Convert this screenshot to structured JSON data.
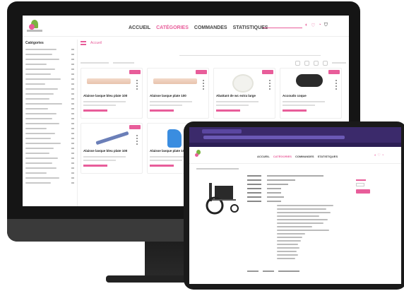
{
  "desktop": {
    "nav": [
      "ACCUEIL",
      "CATÉGORIES",
      "COMMANDES",
      "STATISTIQUES"
    ],
    "nav_active": "CATÉGORIES",
    "sidebar_title": "Catégories",
    "breadcrumb": "Accueil",
    "products": [
      {
        "name": "Alaisse lavque bleu plate 100"
      },
      {
        "name": "Alaisse lavque plate 100"
      },
      {
        "name": "Abattant de wc extra large"
      },
      {
        "name": "Accoudo coque"
      },
      {
        "name": "Alaisse lavque bleu plate 100"
      },
      {
        "name": "Alaisse lavque plate 100"
      }
    ],
    "cart_label": "Panier"
  },
  "tablet": {
    "nav": [
      "ACCUEIL",
      "CATÉGORIES",
      "COMMANDES",
      "STATISTIQUES"
    ],
    "nav_active": "CATÉGORIES"
  },
  "colors": {
    "accent": "#e85d9a",
    "browser_chrome": "#3b2a6b",
    "bezel": "#151515"
  }
}
